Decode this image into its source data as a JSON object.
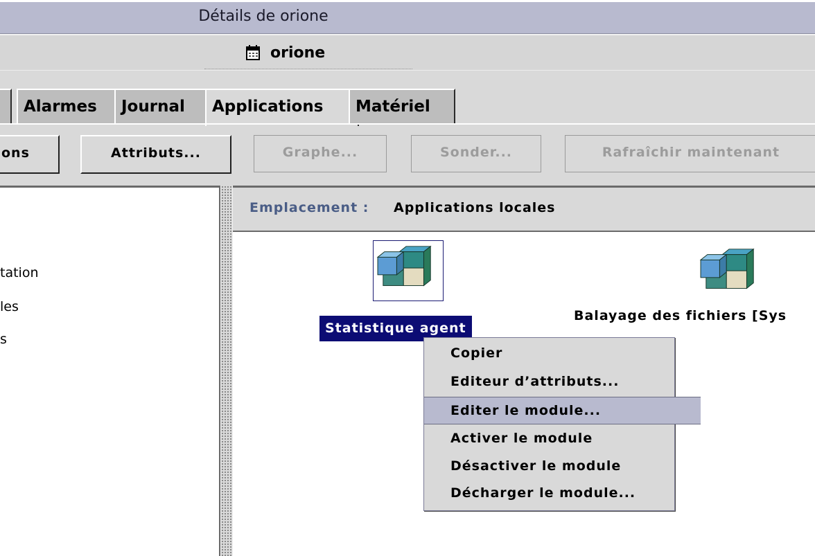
{
  "window": {
    "title": "Détails de orione"
  },
  "header": {
    "host_name": "orione",
    "host_icon": "calendar-icon"
  },
  "tabs": [
    {
      "label": "Alarmes"
    },
    {
      "label": "Journal"
    },
    {
      "label": "Applications"
    },
    {
      "label": "Matériel"
    }
  ],
  "toolbar": {
    "cut_label": "ons",
    "attributs": "Attributs...",
    "graphe": "Graphe...",
    "sonder": "Sonder...",
    "rafraichir": "Rafraîchir maintenant"
  },
  "tree": {
    "items": [
      {
        "label": "tation"
      },
      {
        "label": "les"
      },
      {
        "label": "s"
      }
    ]
  },
  "location": {
    "label": "Emplacement :",
    "value": "Applications locales"
  },
  "modules": [
    {
      "label": "Statistique  agent",
      "icon": "module-cube-icon",
      "selected": true
    },
    {
      "label": "Balayage des fichiers [Sys",
      "icon": "module-cube-icon",
      "selected": false
    }
  ],
  "context_menu": {
    "items": [
      {
        "label": "Copier"
      },
      {
        "label": "Editeur d’attributs..."
      },
      {
        "label": "Editer le module...",
        "highlighted": true
      },
      {
        "label": "Activer le module"
      },
      {
        "label": "Désactiver le module"
      },
      {
        "label": "Décharger le module..."
      }
    ]
  },
  "colors": {
    "title_bar": "#b8bacf",
    "selection": "#0c0c74",
    "location_label": "#4a5d86",
    "menu_highlight": "#b8bacf"
  }
}
